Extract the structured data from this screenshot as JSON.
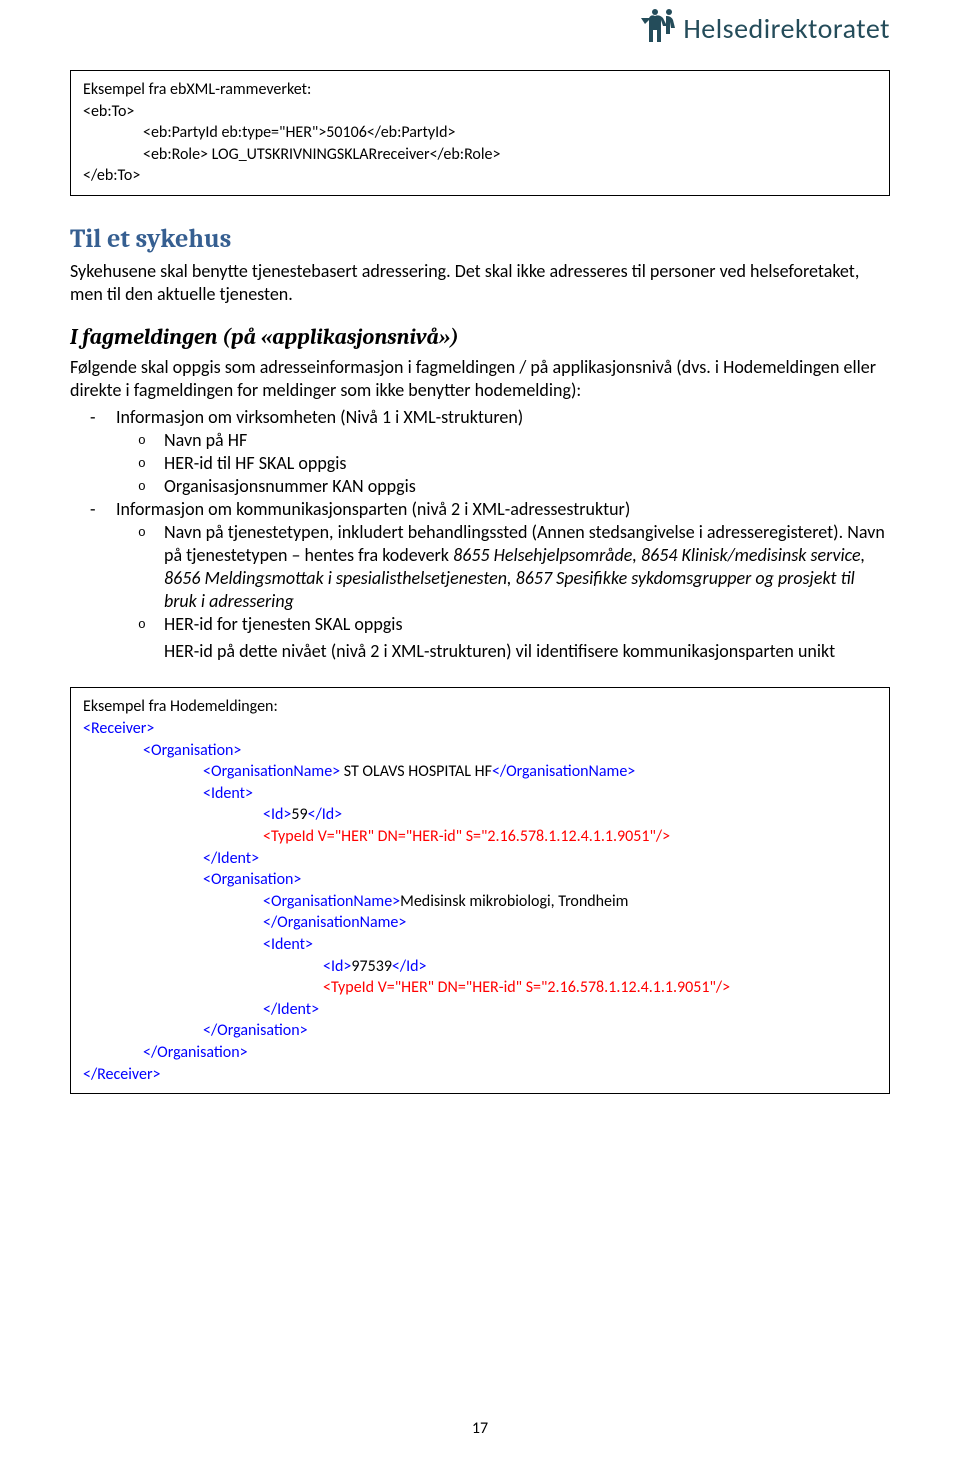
{
  "logo_text": "Helsedirektoratet",
  "box1": {
    "title": "Eksempel fra ebXML-rammeverket:",
    "l1": "<eb:To>",
    "l2": "<eb:PartyId eb:type=\"HER\">50106</eb:PartyId>",
    "l3": "<eb:Role> LOG_UTSKRIVNINGSKLARreceiver</eb:Role>",
    "l4": "</eb:To>"
  },
  "sec_title": "Til et sykehus",
  "para1": "Sykehusene skal benytte tjenestebasert adressering. Det skal ikke adresseres til personer ved helseforetaket, men til den aktuelle tjenesten.",
  "sub_head": "I fagmeldingen (på «applikasjonsnivå»)",
  "para2": "Følgende skal oppgis som adresseinformasjon i fagmeldingen / på applikasjonsnivå (dvs. i Hodemeldingen eller direkte i fagmeldingen for meldinger som ikke benytter hodemelding):",
  "li1": "Informasjon om virksomheten (Nivå 1 i XML-strukturen)",
  "li1a": "Navn på HF",
  "li1b": "HER-id til HF SKAL oppgis",
  "li1c": "Organisasjonsnummer KAN oppgis",
  "li2": "Informasjon om kommunikasjonsparten (nivå 2 i XML-adressestruktur)",
  "li2a_pre": "Navn på tjenestetypen, inkludert behandlingssted (Annen stedsangivelse i adresseregisteret). Navn på tjenestetypen – hentes fra kodeverk ",
  "li2a_ital": "8655 Helsehjelpsområde, 8654 Klinisk/medisinsk service, 8656 Meldingsmottak i spesialisthelsetjenesten, 8657 Spesifikke sykdomsgrupper og prosjekt til bruk i adressering",
  "li2b": "HER-id for tjenesten SKAL oppgis",
  "li2b_text": "HER-id på dette nivået (nivå 2 i XML-strukturen) vil identifisere kommunikasjonsparten unikt",
  "box2": {
    "title": "Eksempel fra Hodemeldingen:",
    "receiver_open": "<Receiver>",
    "org_open": "<Organisation>",
    "orgname_open": "<OrganisationName>",
    "orgname_close": "</OrganisationName>",
    "orgname1_text": " ST OLAVS HOSPITAL HF",
    "ident_open": "<Ident>",
    "ident_close": "</Ident>",
    "id_open": "<Id>",
    "id_close": "</Id>",
    "id1_text": "59",
    "typeid1": "<TypeId V=\"HER\" DN=\"HER-id\" S=\"2.16.578.1.12.4.1.1.9051\"/>",
    "orgname2_text": "Medisinsk mikrobiologi, Trondheim",
    "id2_text": "97539",
    "typeid2": "<TypeId V=\"HER\" DN=\"HER-id\" S=\"2.16.578.1.12.4.1.1.9051\"/>",
    "org_close": "</Organisation>",
    "receiver_close": "</Receiver>"
  },
  "page_num": "17"
}
